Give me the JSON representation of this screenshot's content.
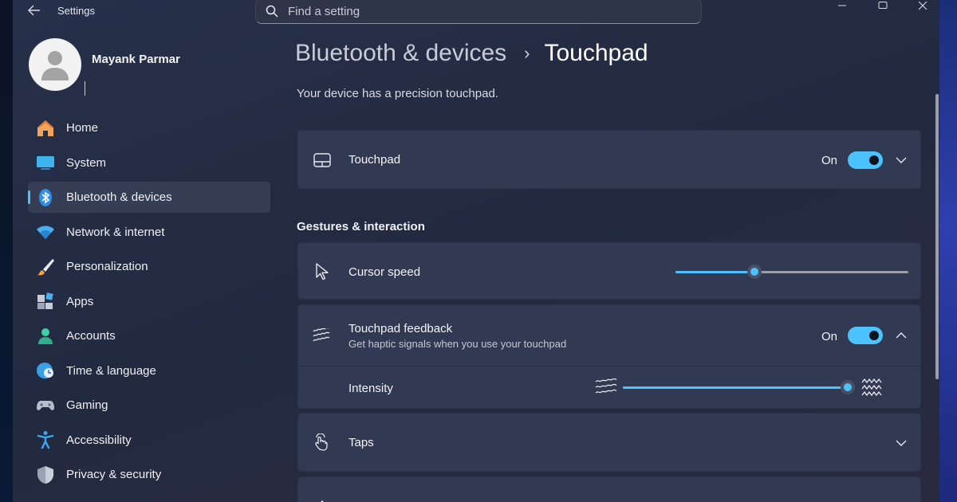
{
  "titlebar": {
    "app_title": "Settings",
    "search_placeholder": "Find a setting"
  },
  "profile": {
    "name": "Mayank Parmar"
  },
  "sidebar": {
    "items": [
      {
        "label": "Home",
        "icon": "home-icon",
        "selected": false
      },
      {
        "label": "System",
        "icon": "system-icon",
        "selected": false
      },
      {
        "label": "Bluetooth & devices",
        "icon": "bluetooth-icon",
        "selected": true
      },
      {
        "label": "Network & internet",
        "icon": "wifi-icon",
        "selected": false
      },
      {
        "label": "Personalization",
        "icon": "brush-icon",
        "selected": false
      },
      {
        "label": "Apps",
        "icon": "apps-icon",
        "selected": false
      },
      {
        "label": "Accounts",
        "icon": "accounts-icon",
        "selected": false
      },
      {
        "label": "Time & language",
        "icon": "globe-clock-icon",
        "selected": false
      },
      {
        "label": "Gaming",
        "icon": "gamepad-icon",
        "selected": false
      },
      {
        "label": "Accessibility",
        "icon": "accessibility-icon",
        "selected": false
      },
      {
        "label": "Privacy & security",
        "icon": "shield-icon",
        "selected": false
      }
    ]
  },
  "main": {
    "breadcrumb_parent": "Bluetooth & devices",
    "breadcrumb_current": "Touchpad",
    "subtitle": "Your device has a precision touchpad.",
    "touchpad": {
      "label": "Touchpad",
      "state": "On",
      "enabled": true
    },
    "section_title": "Gestures & interaction",
    "cursor_speed": {
      "label": "Cursor speed",
      "value_fraction": 0.34
    },
    "feedback": {
      "label": "Touchpad feedback",
      "description": "Get haptic signals when you use your touchpad",
      "state": "On",
      "enabled": true
    },
    "intensity": {
      "label": "Intensity",
      "value_fraction": 1.0
    },
    "taps": {
      "label": "Taps"
    }
  },
  "colors": {
    "accent": "#4cc2ff",
    "card": "#313a52",
    "window": "#242c42"
  }
}
